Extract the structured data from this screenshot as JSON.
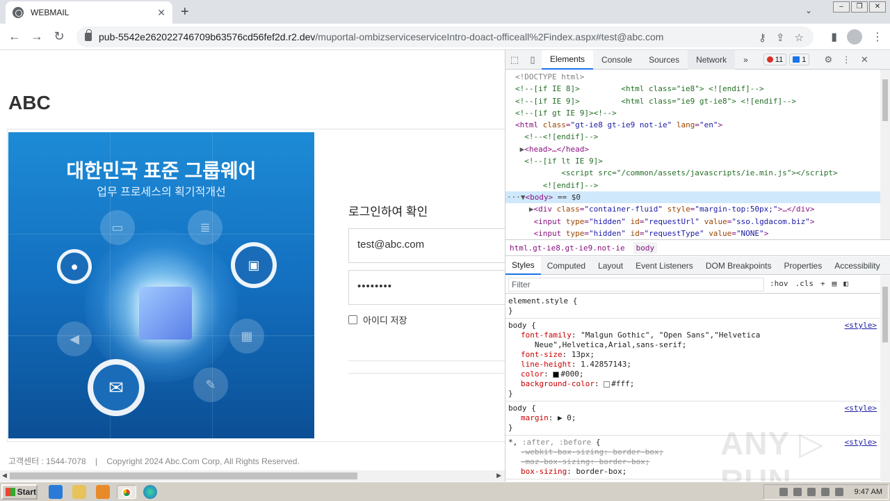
{
  "browser": {
    "tab_title": "WEBMAIL",
    "tab_close": "✕",
    "new_tab": "+",
    "url_host": "pub-5542e262022746709b63576cd56fef2d.r2.dev",
    "url_path": "/muportal-ombizserviceserviceIntro-doact-officeall%2Findex.aspx#test@abc.com"
  },
  "page": {
    "logo": "ABC",
    "hero_title": "대한민국 표준 그룹웨어",
    "hero_subtitle": "업무 프로세스의 획기적개선",
    "login_title": "로그인하여 확인",
    "email_value": "test@abc.com",
    "password_value": "••••••••",
    "remember_label": "아이디 저장",
    "footer": "고객센터 : 1544-7078    |    Copyright 2024 Abc.Com Corp, All Rights Reserved."
  },
  "devtools": {
    "tabs": [
      "Elements",
      "Console",
      "Sources",
      "Network"
    ],
    "more": "»",
    "error_count": "11",
    "message_count": "1",
    "breadcrumbs": [
      "html.gt-ie8.gt-ie9.not-ie",
      "body"
    ],
    "style_tabs": [
      "Styles",
      "Computed",
      "Layout",
      "Event Listeners",
      "DOM Breakpoints",
      "Properties",
      "Accessibility"
    ],
    "filter_placeholder": "Filter",
    "filter_hov": ":hov",
    "filter_cls": ".cls"
  },
  "taskbar": {
    "start": "Start",
    "time": "9:47 AM"
  },
  "watermark": "ANY ▷ RUN"
}
